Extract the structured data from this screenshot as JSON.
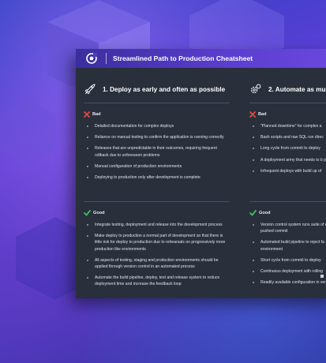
{
  "sheet": {
    "title": "Streamlined Path to Production Cheatsheet",
    "logo_icon": "logo-icon"
  },
  "col1": {
    "title": "1. Deploy as early and often as possible",
    "icon": "rocket-icon",
    "bad": {
      "label": "Bad",
      "items": [
        "Detailed documentation for complex deploys",
        "Reliance on manual testing to confirm the application is running correctly",
        "Releases that are unpredictable in their outcomes, requiring frequent rollback due to unforeseen problems",
        "Manual configuration of production environments",
        " Deploying to production only after development is complete"
      ]
    },
    "good": {
      "label": "Good",
      "items": [
        "Integrate testing, deployment and release into the development process",
        "Make deploy to production a normal part of development so that there is little risk for deploy to production due to rehearsals on progressively more production like environments",
        "All aspects of testing, staging and production environments should be applied through version control in an automated process",
        "Automate the build pipeline, deploy, test and release system to reduce deployment time and increase the feedback loop"
      ]
    }
  },
  "col2": {
    "title": "2. Automate as much a",
    "icon": "gears-icon",
    "bad": {
      "label": "Bad",
      "items": [
        "\"Planned downtime\" for complex a",
        "Bash scripts and raw SQL run direc",
        "Long cycle from commit to deploy",
        "A deployment army that needs to b production",
        "Infrequent deploys with build up of"
      ]
    },
    "good": {
      "label": "Good",
      "items": [
        "Version control system runs suite of each pushed commit",
        "Automated build pipeline to reject fa environment",
        "Short cycle from commit to deploy",
        "Continuous deployment with rolling",
        "Readily available configuration in ver"
      ]
    }
  },
  "colors": {
    "header_gradient_start": "#3a2e9e",
    "header_gradient_end": "#6b48de",
    "sheet_bg": "#2a2f3c",
    "bad_mark": "#e8453c",
    "good_mark": "#3fbf5a"
  }
}
